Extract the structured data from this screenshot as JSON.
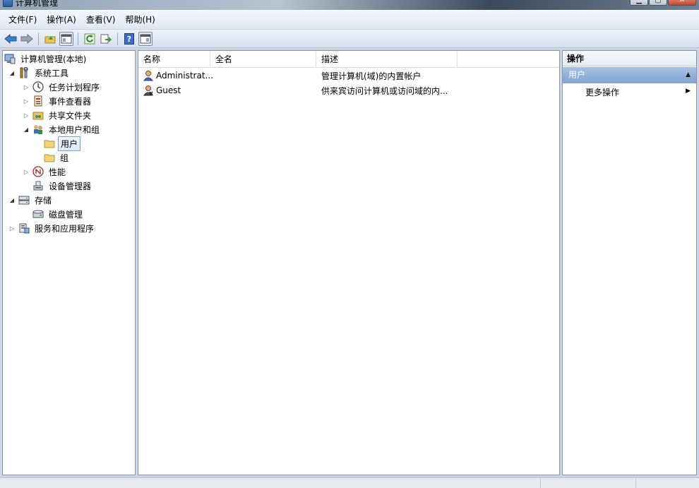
{
  "window": {
    "title": "计算机管理"
  },
  "menu": [
    "文件(F)",
    "操作(A)",
    "查看(V)",
    "帮助(H)"
  ],
  "tree": [
    {
      "label": "计算机管理(本地)",
      "icon": "computer-management-icon"
    },
    {
      "label": "系统工具",
      "icon": "tools-icon"
    },
    {
      "label": "任务计划程序",
      "icon": "clock-icon"
    },
    {
      "label": "事件查看器",
      "icon": "event-viewer-icon"
    },
    {
      "label": "共享文件夹",
      "icon": "shared-folder-icon"
    },
    {
      "label": "本地用户和组",
      "icon": "users-group-icon"
    },
    {
      "label": "用户",
      "icon": "folder-icon"
    },
    {
      "label": "组",
      "icon": "folder-icon"
    },
    {
      "label": "性能",
      "icon": "performance-icon"
    },
    {
      "label": "设备管理器",
      "icon": "device-manager-icon"
    },
    {
      "label": "存储",
      "icon": "storage-icon"
    },
    {
      "label": "磁盘管理",
      "icon": "disk-icon"
    },
    {
      "label": "服务和应用程序",
      "icon": "services-icon"
    }
  ],
  "list": {
    "columns": [
      "名称",
      "全名",
      "描述"
    ],
    "rows": [
      {
        "name": "Administrat...",
        "fullname": "",
        "description": "管理计算机(域)的内置帐户"
      },
      {
        "name": "Guest",
        "fullname": "",
        "description": "供来宾访问计算机或访问域的内..."
      }
    ]
  },
  "actions": {
    "title": "操作",
    "section": "用户",
    "items": [
      "更多操作"
    ]
  },
  "colors": {
    "selection_border": "#7da2ce",
    "action_header": "#7fa3d0"
  }
}
